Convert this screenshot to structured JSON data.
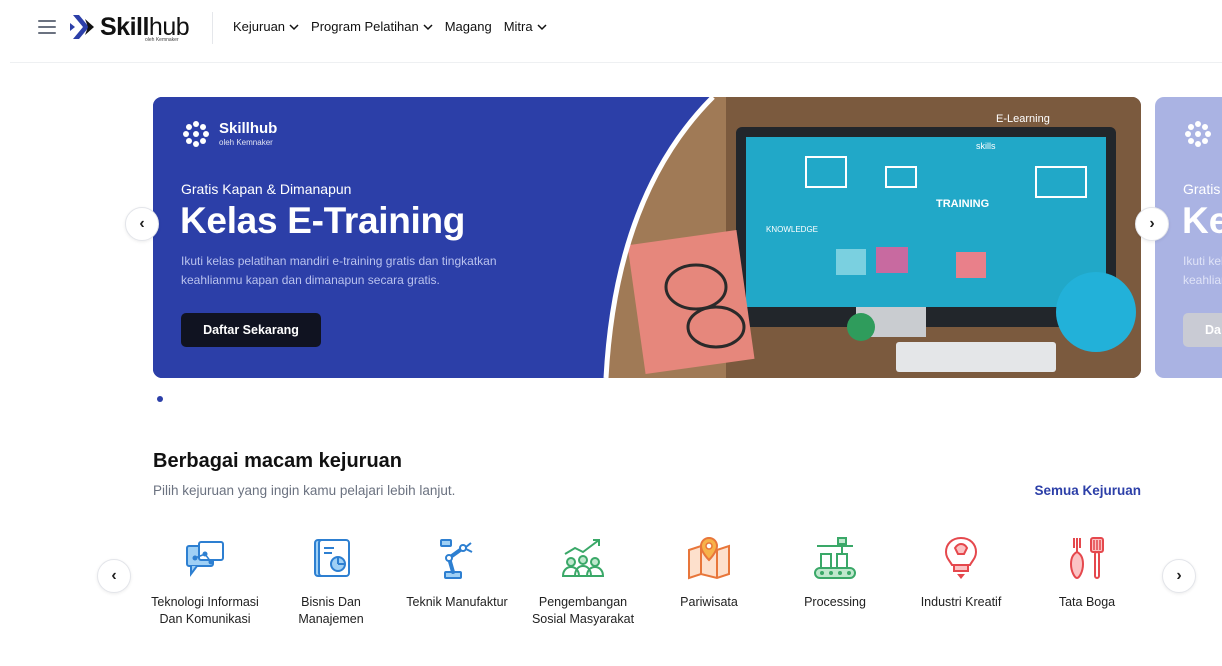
{
  "header": {
    "brand_bold": "Skill",
    "brand_light": "hub",
    "brand_sub": "oleh Kemnaker",
    "nav": [
      {
        "label": "Kejuruan",
        "dropdown": true
      },
      {
        "label": "Program Pelatihan",
        "dropdown": true
      },
      {
        "label": "Magang",
        "dropdown": false
      },
      {
        "label": "Mitra",
        "dropdown": true
      }
    ]
  },
  "banner": {
    "logo_name": "Skillhub",
    "logo_sub": "oleh Kemnaker",
    "kicker": "Gratis Kapan & Dimanapun",
    "title": "Kelas E-Training",
    "description": "Ikuti kelas pelatihan mandiri e-training gratis dan tingkatkan keahlianmu kapan dan dimanapun secara gratis.",
    "cta": "Daftar Sekarang",
    "photo_texts": [
      "E-Learning",
      "TRAINING",
      "KNOWLEDGE",
      "skills"
    ],
    "colors": {
      "bg": "#2c3fa8",
      "button": "#101321"
    }
  },
  "banner_next": {
    "kicker": "Gratis",
    "title": "Ke",
    "description": "Ikuti kelas pelatihan mandiri e-training gratis dan tingkatkan keahlianmu kapan dan dimanapun secara gratis.",
    "cta": "Da"
  },
  "carousel": {
    "prev_icon": "‹",
    "next_icon": "›",
    "active_dot": 0
  },
  "section": {
    "title": "Berbagai macam kejuruan",
    "subtitle": "Pilih kejuruan yang ingin kamu pelajari lebih lanjut.",
    "link": "Semua Kejuruan"
  },
  "categories": [
    {
      "label": "Teknologi Informasi Dan Komunikasi",
      "icon": "chat-network-icon"
    },
    {
      "label": "Bisnis Dan Manajemen",
      "icon": "document-chart-icon"
    },
    {
      "label": "Teknik Manufaktur",
      "icon": "robot-arm-icon"
    },
    {
      "label": "Pengembangan Sosial Masyarakat",
      "icon": "people-growth-icon"
    },
    {
      "label": "Pariwisata",
      "icon": "map-pin-icon"
    },
    {
      "label": "Processing",
      "icon": "conveyor-icon"
    },
    {
      "label": "Industri Kreatif",
      "icon": "lightbulb-icon"
    },
    {
      "label": "Tata Boga",
      "icon": "kitchen-utensils-icon"
    }
  ],
  "colors": {
    "accent": "#2c3fa8",
    "icon_blue": "#2d7fd1",
    "icon_green": "#3aa868",
    "icon_orange": "#e8763a",
    "icon_red": "#e5484d"
  }
}
